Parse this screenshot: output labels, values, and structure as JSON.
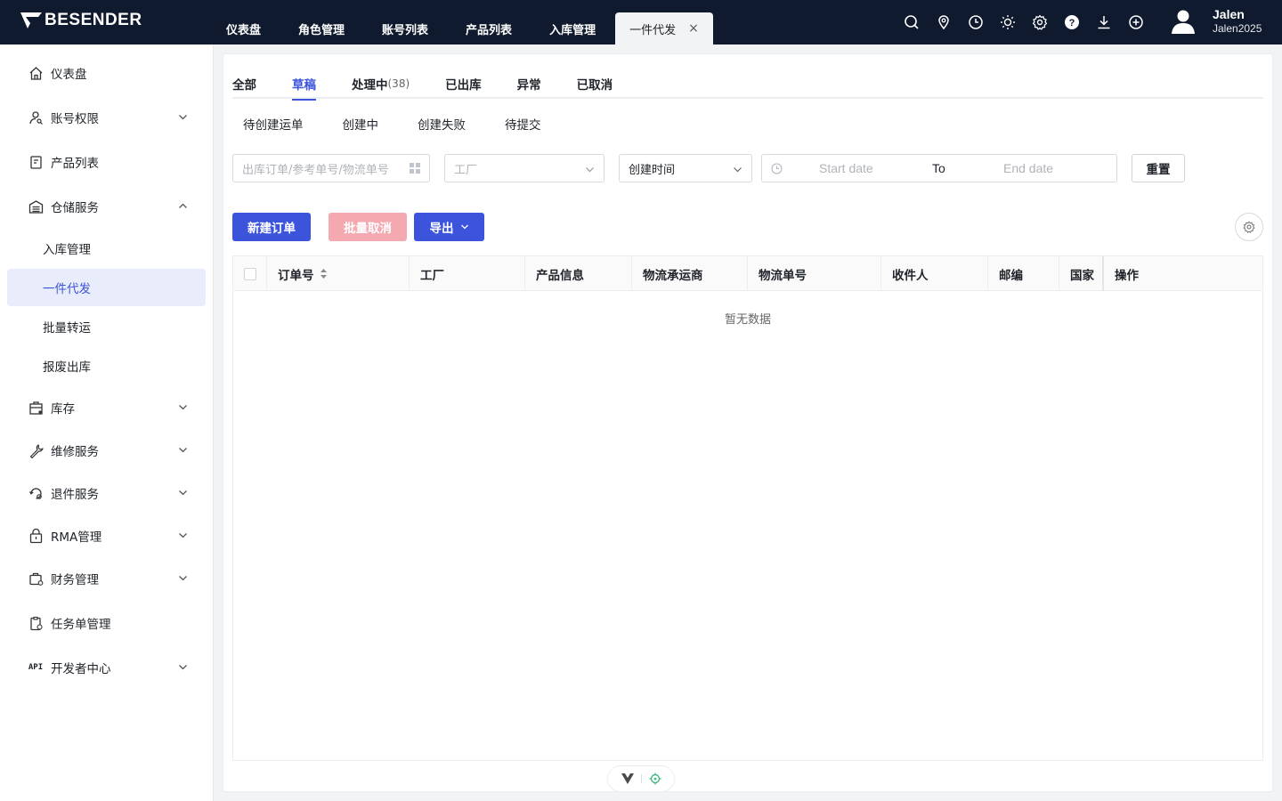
{
  "brand": {
    "name": "BESENDER"
  },
  "topnav": {
    "tabs": [
      {
        "label": "仪表盘"
      },
      {
        "label": "角色管理"
      },
      {
        "label": "账号列表"
      },
      {
        "label": "产品列表"
      },
      {
        "label": "入库管理"
      },
      {
        "label": "一件代发",
        "active": true
      }
    ],
    "close_glyph": "×",
    "icons": [
      "search-icon",
      "location-icon",
      "clock-icon",
      "sun-icon",
      "gear-icon",
      "help-icon",
      "download-icon",
      "add-circle-icon"
    ]
  },
  "user": {
    "name": "Jalen",
    "account": "Jalen2025"
  },
  "sidebar": {
    "items": [
      {
        "label": "仪表盘",
        "icon": "home-icon"
      },
      {
        "label": "账号权限",
        "icon": "user-key-icon",
        "expandable": true
      },
      {
        "label": "产品列表",
        "icon": "product-icon"
      },
      {
        "label": "仓储服务",
        "icon": "warehouse-icon",
        "expandable": true,
        "expanded": true
      },
      {
        "label": "库存",
        "icon": "inventory-icon",
        "expandable": true
      },
      {
        "label": "维修服务",
        "icon": "wrench-icon",
        "expandable": true
      },
      {
        "label": "退件服务",
        "icon": "return-icon",
        "expandable": true
      },
      {
        "label": "RMA管理",
        "icon": "rma-icon",
        "expandable": true
      },
      {
        "label": "财务管理",
        "icon": "finance-icon",
        "expandable": true
      },
      {
        "label": "任务单管理",
        "icon": "task-icon"
      },
      {
        "label": "开发者中心",
        "icon": "api-icon",
        "icon_text": "API",
        "expandable": true
      }
    ],
    "subitems": [
      {
        "label": "入库管理"
      },
      {
        "label": "一件代发",
        "active": true
      },
      {
        "label": "批量转运"
      },
      {
        "label": "报废出库"
      }
    ]
  },
  "status_tabs": [
    {
      "label": "全部"
    },
    {
      "label": "草稿",
      "active": true
    },
    {
      "label": "处理中",
      "count": "(38)"
    },
    {
      "label": "已出库"
    },
    {
      "label": "异常"
    },
    {
      "label": "已取消"
    }
  ],
  "sub_tabs": [
    {
      "label": "待创建运单"
    },
    {
      "label": "创建中"
    },
    {
      "label": "创建失败"
    },
    {
      "label": "待提交"
    }
  ],
  "filters": {
    "search_placeholder": "出库订单/参考单号/物流单号",
    "factory_placeholder": "工厂",
    "time_type": "创建时间",
    "start_placeholder": "Start date",
    "range_sep": "To",
    "end_placeholder": "End date",
    "reset_label": "重置"
  },
  "actions": {
    "new_order": "新建订单",
    "batch_cancel": "批量取消",
    "export": "导出"
  },
  "table": {
    "columns": [
      "订单号",
      "工厂",
      "产品信息",
      "物流承运商",
      "物流单号",
      "收件人",
      "邮编",
      "国家",
      "操作"
    ],
    "empty_text": "暂无数据"
  },
  "colors": {
    "primary": "#3b54db",
    "topbar": "#0f1a2e",
    "disabled_danger": "#f4a9b1"
  }
}
